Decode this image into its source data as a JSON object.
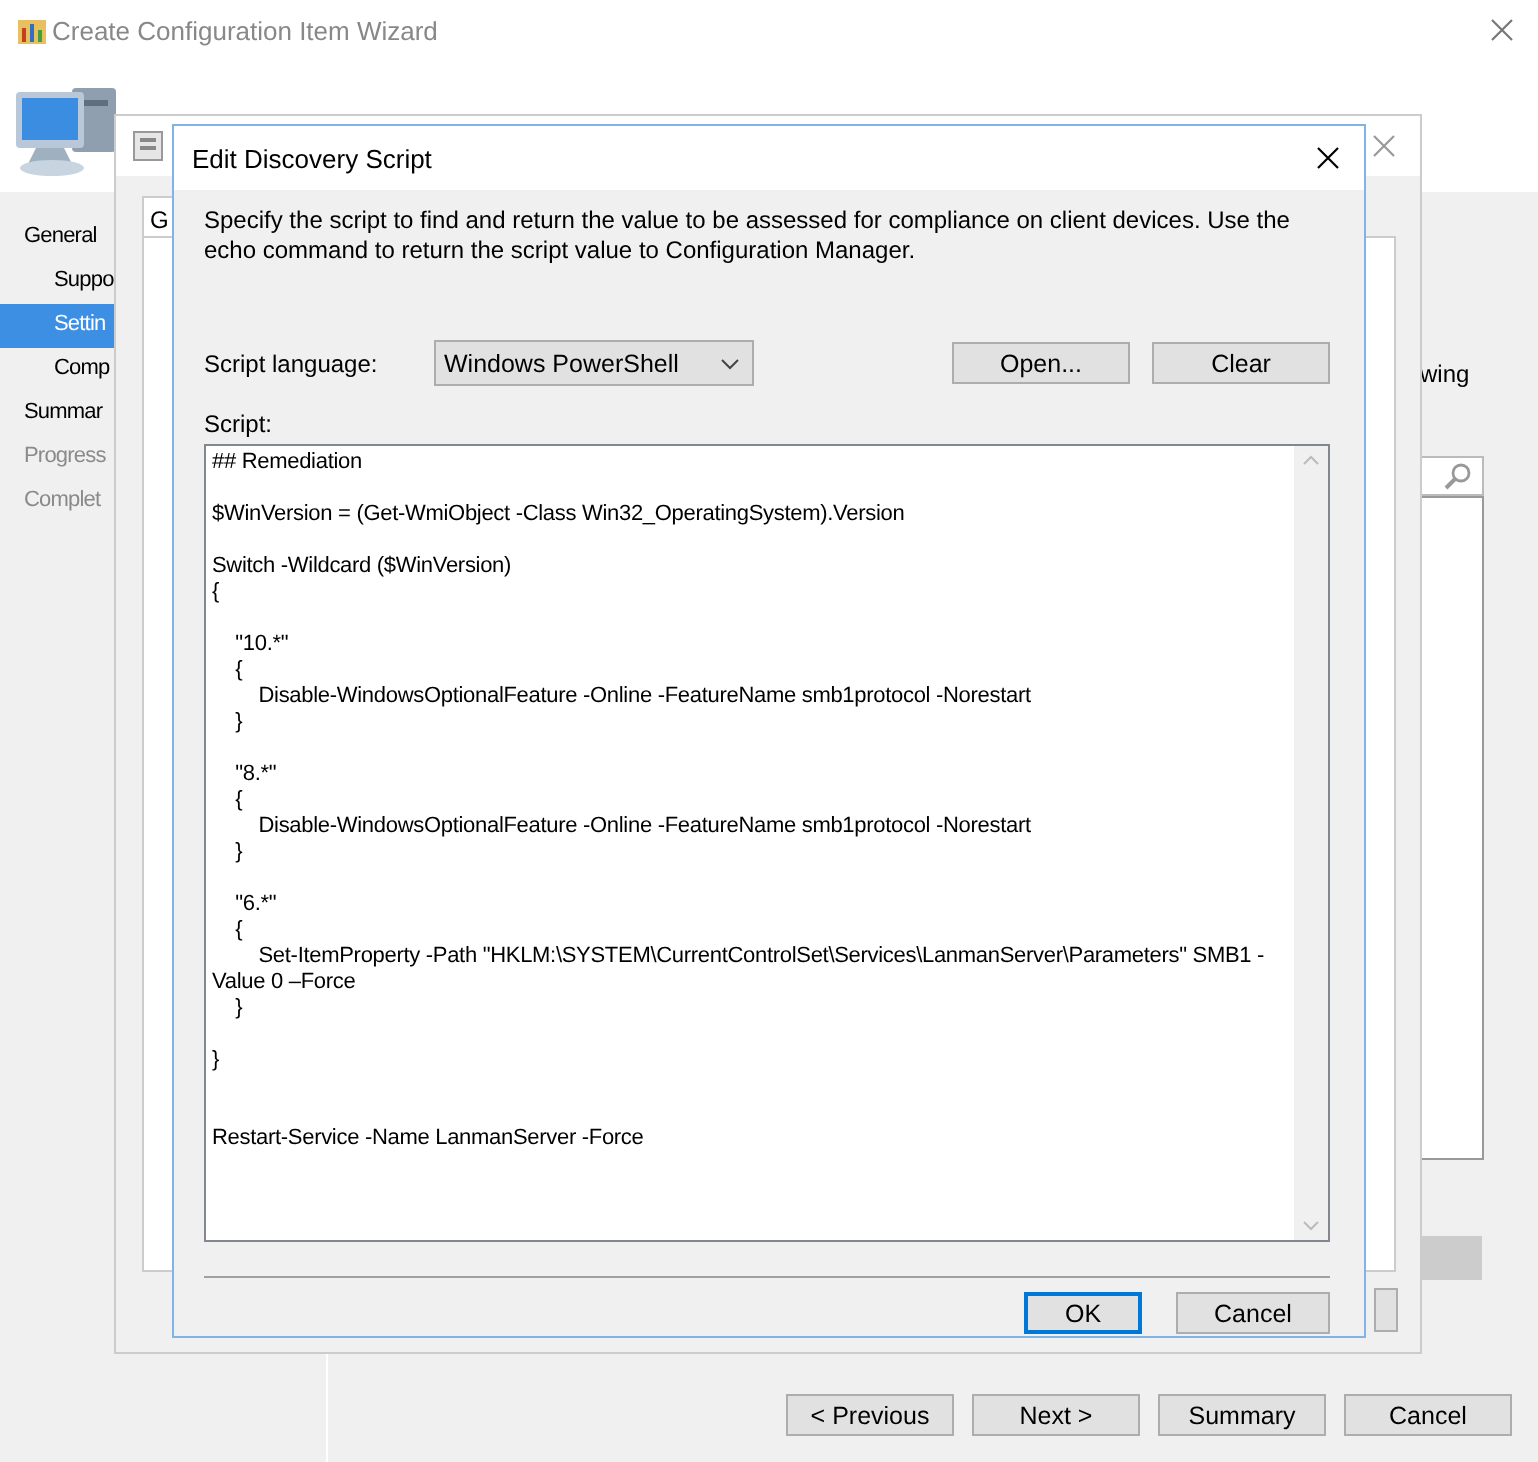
{
  "wizard": {
    "title": "Create Configuration Item Wizard",
    "nav": [
      {
        "label": "General",
        "selected": false,
        "disabled": false,
        "children": [
          {
            "label": "Suppo",
            "selected": false,
            "disabled": false
          },
          {
            "label": "Settin",
            "selected": true,
            "disabled": false
          },
          {
            "label": "Comp",
            "selected": false,
            "disabled": false
          }
        ]
      },
      {
        "label": "Summar",
        "selected": false,
        "disabled": false
      },
      {
        "label": "Progress",
        "selected": false,
        "disabled": true
      },
      {
        "label": "Complet",
        "selected": false,
        "disabled": true
      }
    ],
    "side_text": "wing",
    "buttons": [
      "< Previous",
      "Next >",
      "Summary",
      "Cancel"
    ]
  },
  "settings_window": {
    "tab": "G"
  },
  "dialog": {
    "title": "Edit Discovery Script",
    "description": "Specify the script to find and return the value to be assessed for compliance on client devices. Use the echo command to return the script value to Configuration Manager.",
    "language_label": "Script language:",
    "language": "Windows PowerShell",
    "open_button": "Open...",
    "clear_button": "Clear",
    "script_label": "Script:",
    "script": "## Remediation\n\n$WinVersion = (Get-WmiObject -Class Win32_OperatingSystem).Version\n\nSwitch -Wildcard ($WinVersion)\n{\n\n    \"10.*\"\n    {\n        Disable-WindowsOptionalFeature -Online -FeatureName smb1protocol -Norestart\n    }\n\n    \"8.*\"\n    {\n        Disable-WindowsOptionalFeature -Online -FeatureName smb1protocol -Norestart\n    }\n\n    \"6.*\"\n    {\n        Set-ItemProperty -Path \"HKLM:\\SYSTEM\\CurrentControlSet\\Services\\LanmanServer\\Parameters\" SMB1 -\nValue 0 –Force\n    }\n\n}\n\n\nRestart-Service -Name LanmanServer -Force",
    "buttons": [
      "OK",
      "Cancel"
    ]
  }
}
